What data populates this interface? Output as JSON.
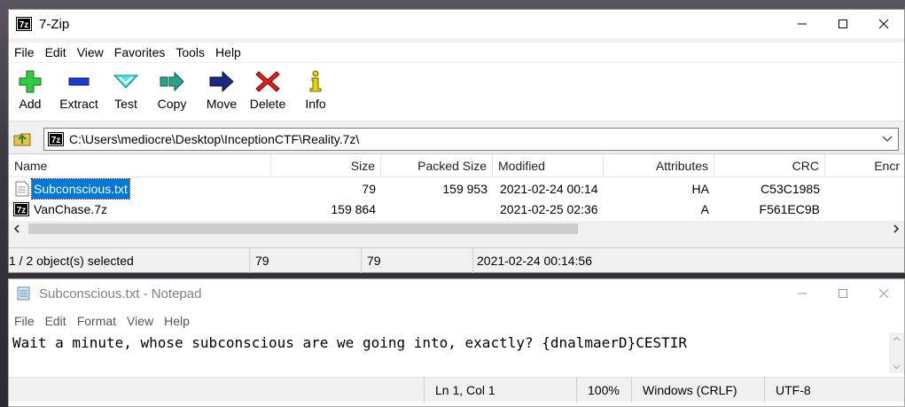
{
  "zip": {
    "title": "7-Zip",
    "menu": [
      "File",
      "Edit",
      "View",
      "Favorites",
      "Tools",
      "Help"
    ],
    "toolbar": {
      "add": "Add",
      "extract": "Extract",
      "test": "Test",
      "copy": "Copy",
      "move": "Move",
      "delete": "Delete",
      "info": "Info"
    },
    "address": "C:\\Users\\mediocre\\Desktop\\InceptionCTF\\Reality.7z\\",
    "columns": {
      "name": "Name",
      "size": "Size",
      "packed": "Packed Size",
      "modified": "Modified",
      "attributes": "Attributes",
      "crc": "CRC",
      "encrypted": "Encr"
    },
    "files": [
      {
        "name": "Subconscious.txt",
        "size": "79",
        "packed": "159 953",
        "modified": "2021-02-24 00:14",
        "attributes": "HA",
        "crc": "C53C1985"
      },
      {
        "name": "VanChase.7z",
        "size": "159 864",
        "packed": "",
        "modified": "2021-02-25 02:36",
        "attributes": "A",
        "crc": "F561EC9B"
      }
    ],
    "status": {
      "selected": "1 / 2 object(s) selected",
      "size": "79",
      "packed": "79",
      "modified": "2021-02-24 00:14:56"
    },
    "colors": {
      "accent": "#0078d7"
    }
  },
  "notepad": {
    "title": "Subconscious.txt - Notepad",
    "menu": [
      "File",
      "Edit",
      "Format",
      "View",
      "Help"
    ],
    "content": "Wait a minute, whose subconscious are we going into, exactly? {dnalmaerD}CESTIR",
    "status": {
      "position": "Ln 1, Col 1",
      "zoom": "100%",
      "line_ending": "Windows (CRLF)",
      "encoding": "UTF-8"
    }
  }
}
